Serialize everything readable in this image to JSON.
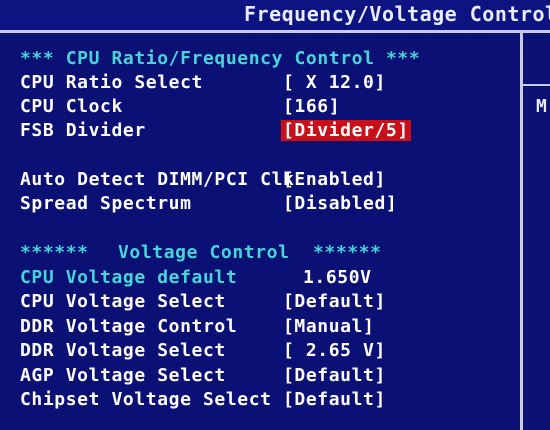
{
  "header": {
    "title": "Frequency/Voltage Control"
  },
  "right_panel": {
    "letter": "M"
  },
  "cpu_section": {
    "heading": "*** CPU Ratio/Frequency Control ***",
    "items": [
      {
        "label": "CPU Ratio Select",
        "value": "[ X 12.0]"
      },
      {
        "label": "CPU Clock",
        "value": "[166]"
      },
      {
        "label": "FSB Divider",
        "value": "[Divider/5]"
      }
    ]
  },
  "clock_section": {
    "items": [
      {
        "label": "Auto Detect DIMM/PCI Clk",
        "value": "[Enabled]"
      },
      {
        "label": "Spread Spectrum",
        "value": "[Disabled]"
      }
    ]
  },
  "voltage_section": {
    "heading_left": "******",
    "heading_title": "Voltage Control",
    "heading_right": "******",
    "default_label": "CPU Voltage default",
    "default_value": "1.650V",
    "items": [
      {
        "label": "CPU Voltage Select",
        "value": "[Default]"
      },
      {
        "label": "DDR Voltage Control",
        "value": "[Manual]"
      },
      {
        "label": "DDR Voltage Select",
        "value": "[ 2.65 V]"
      },
      {
        "label": "AGP Voltage Select",
        "value": "[Default]"
      },
      {
        "label": "Chipset Voltage Select",
        "value": "[Default]"
      }
    ]
  },
  "colors": {
    "background": "#0b1075",
    "heading": "#46d5d8",
    "text": "#ffffff",
    "highlight": "#c8101a",
    "border": "#c9cce8"
  }
}
